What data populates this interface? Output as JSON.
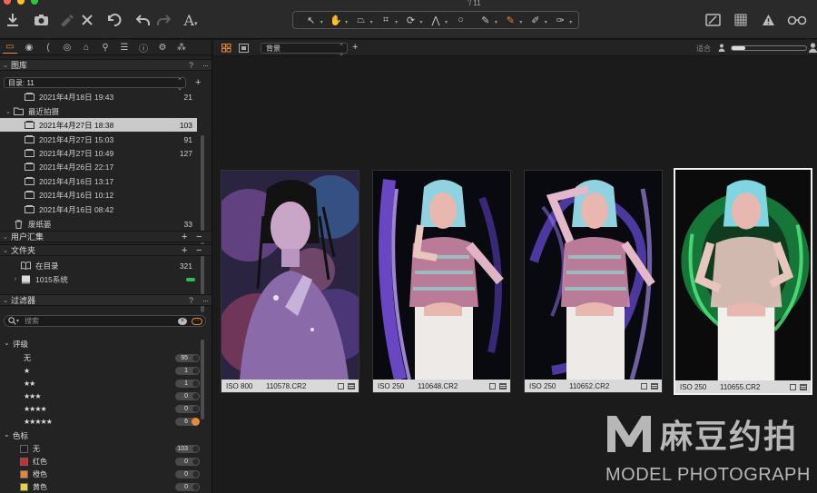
{
  "window": {
    "title_fragment": "’/ 11"
  },
  "toolbar": {
    "left_icons": [
      "import-icon",
      "camera-icon",
      "eyedropper-disabled-icon",
      "close-icon",
      "reset-undo-icon",
      "undo-icon",
      "redo-icon",
      "text-icon"
    ],
    "center_tools": [
      {
        "name": "cursor-tool-icon",
        "glyph": "↖",
        "active": false
      },
      {
        "name": "pan-tool-icon",
        "glyph": "✋",
        "active": false
      },
      {
        "name": "keystone-tool-icon",
        "glyph": "⏢",
        "active": false
      },
      {
        "name": "crop-tool-icon",
        "glyph": "⌗",
        "active": false
      },
      {
        "name": "rotate-tool-icon",
        "glyph": "⟳",
        "active": false
      },
      {
        "name": "keystone-lines-icon",
        "glyph": "⋀",
        "active": false
      },
      {
        "name": "spot-removal-icon",
        "glyph": "○",
        "active": false
      },
      {
        "name": "brush-icon",
        "glyph": "✎",
        "active": false
      },
      {
        "name": "mask-brush-icon",
        "glyph": "✎",
        "active": true
      },
      {
        "name": "eraser-icon",
        "glyph": "✐",
        "active": false
      },
      {
        "name": "eyedropper-icon",
        "glyph": "✑",
        "active": false
      }
    ],
    "right_icons": [
      "edit-mask-icon",
      "grid-icon",
      "warning-icon",
      "glasses-icon"
    ]
  },
  "sidebar": {
    "tabs": [
      "folder-tab-icon",
      "camera-tab-icon",
      "lens-tab-icon",
      "color-tab-icon",
      "exposure-tab-icon",
      "details-tab-icon",
      "metadata-tab-icon",
      "info-tab-icon",
      "settings-tab-icon",
      "batch-tab-icon"
    ],
    "library": {
      "title": "图库",
      "help": "?",
      "more": "···",
      "catalog_label": "目录: 11",
      "add": "+",
      "tree": [
        {
          "label": "2021年4月18日 19:43",
          "count": "21",
          "indent": 2,
          "icon": "album",
          "selected": false
        },
        {
          "label": "最近拍摄",
          "count": "",
          "indent": 1,
          "icon": "folder",
          "arrow": "⌄",
          "selected": false
        },
        {
          "label": "2021年4月27日 18:38",
          "count": "103",
          "indent": 2,
          "icon": "album",
          "selected": true
        },
        {
          "label": "2021年4月27日 15:03",
          "count": "91",
          "indent": 2,
          "icon": "album",
          "selected": false
        },
        {
          "label": "2021年4月27日 10:49",
          "count": "127",
          "indent": 2,
          "icon": "album",
          "selected": false
        },
        {
          "label": "2021年4月26日 22:17",
          "count": "",
          "indent": 2,
          "icon": "album",
          "selected": false
        },
        {
          "label": "2021年4月16日 13:17",
          "count": "",
          "indent": 2,
          "icon": "album",
          "selected": false
        },
        {
          "label": "2021年4月16日 10:12",
          "count": "",
          "indent": 2,
          "icon": "album",
          "selected": false
        },
        {
          "label": "2021年4月16日 08:42",
          "count": "",
          "indent": 2,
          "icon": "album",
          "selected": false
        },
        {
          "label": "废纸篓",
          "count": "33",
          "indent": 1,
          "icon": "trash",
          "selected": false
        }
      ],
      "user_collections": {
        "label": "用户汇集",
        "plus": "+",
        "minus": "−"
      },
      "folders": {
        "label": "文件夹",
        "plus": "+",
        "minus": "−",
        "items": [
          {
            "label": "在目录",
            "count": "321",
            "icon": "book"
          },
          {
            "label": "1015系统",
            "count": "",
            "icon": "drive",
            "arrow": "›"
          }
        ]
      }
    },
    "filters": {
      "title": "过滤器",
      "help": "?",
      "more": "···",
      "search_placeholder": "搜索",
      "rating_title": "评级",
      "ratings": [
        {
          "label": "无",
          "count": "95",
          "knob": "dark"
        },
        {
          "label": "★",
          "count": "1",
          "knob": "dark"
        },
        {
          "label": "★★",
          "count": "1",
          "knob": "dark"
        },
        {
          "label": "★★★",
          "count": "0",
          "knob": "dark"
        },
        {
          "label": "★★★★",
          "count": "0",
          "knob": "dark"
        },
        {
          "label": "★★★★★",
          "count": "6",
          "knob": "orange"
        }
      ],
      "color_title": "色标",
      "colors": [
        {
          "label": "无",
          "count": "103",
          "color": "#1e1e1e"
        },
        {
          "label": "红色",
          "count": "0",
          "color": "#d9262b"
        },
        {
          "label": "橙色",
          "count": "0",
          "color": "#e8862f"
        },
        {
          "label": "黄色",
          "count": "0",
          "color": "#e6d23a"
        }
      ]
    }
  },
  "viewer": {
    "sort_label": "背景",
    "add": "+",
    "fit_label": "适合",
    "thumb_size_fraction": 0.18,
    "thumbnails": [
      {
        "iso": "ISO 800",
        "filename": "110578.CR2",
        "selected": false,
        "style": "galaxy"
      },
      {
        "iso": "ISO 250",
        "filename": "110648.CR2",
        "selected": false,
        "style": "purple"
      },
      {
        "iso": "ISO 250",
        "filename": "110652.CR2",
        "selected": false,
        "style": "purple2"
      },
      {
        "iso": "ISO 250",
        "filename": "110655.CR2",
        "selected": true,
        "style": "green"
      }
    ]
  },
  "watermark": {
    "letter": "M",
    "chinese": "麻豆约拍",
    "english": "MODEL PHOTOGRAPH"
  },
  "colors": {
    "accent": "#e8883a",
    "panel": "#232323",
    "background": "#1b1b1b"
  }
}
